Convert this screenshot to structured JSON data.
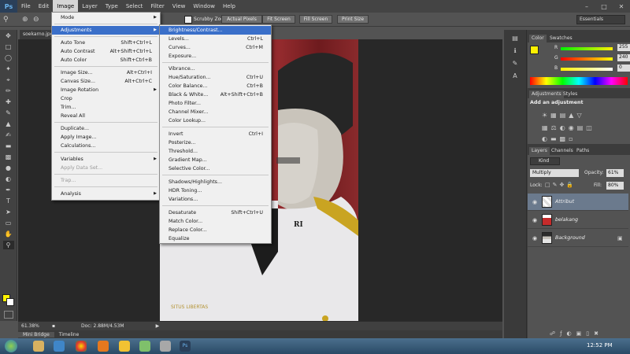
{
  "menubar": {
    "logo": "Ps",
    "items": [
      "File",
      "Edit",
      "Image",
      "Layer",
      "Type",
      "Select",
      "Filter",
      "View",
      "Window",
      "Help"
    ],
    "active_index": 2
  },
  "options_bar": {
    "buttons": [
      "Scrubby Zoom",
      "Actual Pixels",
      "Fit Screen",
      "Fill Screen",
      "Print Size"
    ],
    "workspace": "Essentials"
  },
  "document": {
    "tab_title": "soekarno.jpg"
  },
  "image_menu": {
    "items": [
      {
        "label": "Mode",
        "shortcut": "",
        "submenu": true,
        "disabled": false
      },
      {
        "label": "Adjustments",
        "shortcut": "",
        "submenu": true,
        "disabled": false,
        "highlighted": true
      },
      {
        "label": "Auto Tone",
        "shortcut": "Shift+Ctrl+L"
      },
      {
        "label": "Auto Contrast",
        "shortcut": "Alt+Shift+Ctrl+L"
      },
      {
        "label": "Auto Color",
        "shortcut": "Shift+Ctrl+B"
      },
      {
        "label": "Image Size...",
        "shortcut": "Alt+Ctrl+I"
      },
      {
        "label": "Canvas Size...",
        "shortcut": "Alt+Ctrl+C"
      },
      {
        "label": "Image Rotation",
        "shortcut": "",
        "submenu": true
      },
      {
        "label": "Crop",
        "shortcut": ""
      },
      {
        "label": "Trim...",
        "shortcut": ""
      },
      {
        "label": "Reveal All",
        "shortcut": ""
      },
      {
        "label": "Duplicate...",
        "shortcut": ""
      },
      {
        "label": "Apply Image...",
        "shortcut": ""
      },
      {
        "label": "Calculations...",
        "shortcut": ""
      },
      {
        "label": "Variables",
        "shortcut": "",
        "submenu": true
      },
      {
        "label": "Apply Data Set...",
        "shortcut": "",
        "disabled": true
      },
      {
        "label": "Trap...",
        "shortcut": "",
        "disabled": true
      },
      {
        "label": "Analysis",
        "shortcut": "",
        "submenu": true
      }
    ]
  },
  "adjustments_menu": {
    "items": [
      {
        "label": "Brightness/Contrast...",
        "shortcut": "",
        "highlighted": true
      },
      {
        "label": "Levels...",
        "shortcut": "Ctrl+L"
      },
      {
        "label": "Curves...",
        "shortcut": "Ctrl+M"
      },
      {
        "label": "Exposure...",
        "shortcut": ""
      },
      {
        "label": "Vibrance...",
        "shortcut": ""
      },
      {
        "label": "Hue/Saturation...",
        "shortcut": "Ctrl+U"
      },
      {
        "label": "Color Balance...",
        "shortcut": "Ctrl+B"
      },
      {
        "label": "Black & White...",
        "shortcut": "Alt+Shift+Ctrl+B"
      },
      {
        "label": "Photo Filter...",
        "shortcut": ""
      },
      {
        "label": "Channel Mixer...",
        "shortcut": ""
      },
      {
        "label": "Color Lookup...",
        "shortcut": ""
      },
      {
        "label": "Invert",
        "shortcut": "Ctrl+I"
      },
      {
        "label": "Posterize...",
        "shortcut": ""
      },
      {
        "label": "Threshold...",
        "shortcut": ""
      },
      {
        "label": "Gradient Map...",
        "shortcut": ""
      },
      {
        "label": "Selective Color...",
        "shortcut": ""
      },
      {
        "label": "Shadows/Highlights...",
        "shortcut": ""
      },
      {
        "label": "HDR Toning...",
        "shortcut": ""
      },
      {
        "label": "Variations...",
        "shortcut": ""
      },
      {
        "label": "Desaturate",
        "shortcut": "Shift+Ctrl+U"
      },
      {
        "label": "Match Color...",
        "shortcut": ""
      },
      {
        "label": "Replace Color...",
        "shortcut": ""
      },
      {
        "label": "Equalize",
        "shortcut": ""
      }
    ]
  },
  "photo": {
    "badge": "RI",
    "watermark": "SITUS LIBERTAS"
  },
  "status_bar": {
    "zoom": "61.38%",
    "doc": "Doc: 2.88M/4.53M"
  },
  "bottom_tabs": [
    "Mini Bridge",
    "Timeline"
  ],
  "color_panel": {
    "tabs": [
      "Color",
      "Swatches"
    ],
    "channels": [
      {
        "label": "R",
        "value": "255"
      },
      {
        "label": "G",
        "value": "240"
      },
      {
        "label": "B",
        "value": "0"
      }
    ],
    "foreground_hex": "#fff000"
  },
  "adjustments_panel": {
    "tabs": [
      "Adjustments",
      "Styles"
    ],
    "title": "Add an adjustment"
  },
  "layers_panel": {
    "tabs": [
      "Layers",
      "Channels",
      "Paths"
    ],
    "filter": "Kind",
    "blend_mode": "Multiply",
    "opacity_label": "Opacity:",
    "opacity": "61%",
    "lock_label": "Lock:",
    "fill_label": "Fill:",
    "fill": "80%",
    "layers": [
      {
        "name": "Attribut",
        "selected": true
      },
      {
        "name": "belakang",
        "selected": false
      },
      {
        "name": "Background",
        "selected": false,
        "locked": true
      }
    ]
  },
  "taskbar": {
    "time": "12:52 PM"
  }
}
